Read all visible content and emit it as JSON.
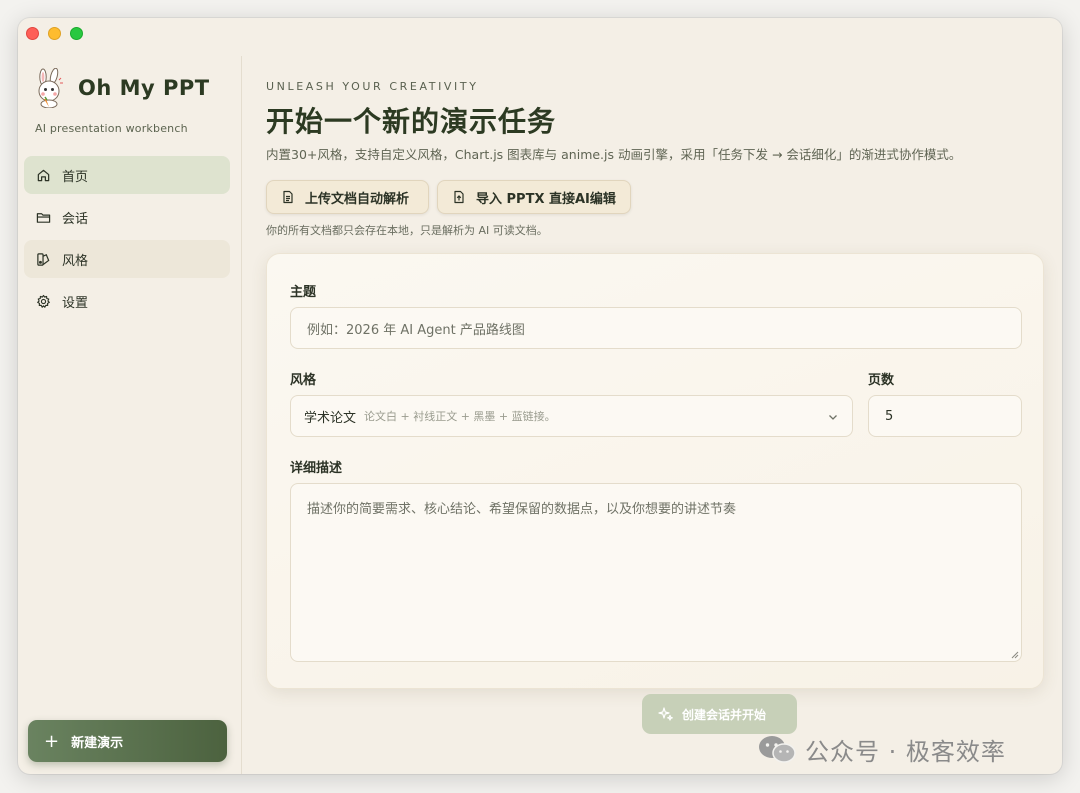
{
  "window": {
    "controls": [
      "close",
      "minimize",
      "zoom"
    ]
  },
  "sidebar": {
    "brand_name": "Oh My PPT",
    "brand_subtitle": "AI presentation workbench",
    "items": [
      {
        "label": "首页",
        "icon": "home-icon",
        "active": true
      },
      {
        "label": "会话",
        "icon": "folder-icon",
        "active": false
      },
      {
        "label": "风格",
        "icon": "style-icon",
        "active": false,
        "hovered": true
      },
      {
        "label": "设置",
        "icon": "gear-icon",
        "active": false
      }
    ],
    "new_button_label": "新建演示"
  },
  "main": {
    "eyebrow": "UNLEASH YOUR CREATIVITY",
    "title": "开始一个新的演示任务",
    "subtitle": "内置30+风格，支持自定义风格，Chart.js 图表库与 anime.js 动画引擎，采用「任务下发 → 会话细化」的渐进式协作模式。",
    "upload_button": "上传文档自动解析",
    "import_button": "导入 PPTX 直接AI编辑",
    "storage_note": "你的所有文档都只会存在本地，只是解析为 AI 可读文档。",
    "form": {
      "topic_label": "主题",
      "topic_placeholder": "例如：2026 年 AI Agent 产品路线图",
      "style_label": "风格",
      "style_selected": "学术论文",
      "style_description": "论文白 + 衬线正文 + 黑墨 + 蓝链接。",
      "pages_label": "页数",
      "pages_value": "5",
      "detail_label": "详细描述",
      "detail_placeholder": "描述你的简要需求、核心结论、希望保留的数据点，以及你想要的讲述节奏"
    },
    "create_button": "创建会话并开始"
  },
  "watermark": {
    "text": "公众号 · 极客效率"
  },
  "colors": {
    "accent": "#4c623f",
    "title": "#2c3a22",
    "active_nav": "#dee3cf",
    "background": "#f4efe6"
  }
}
